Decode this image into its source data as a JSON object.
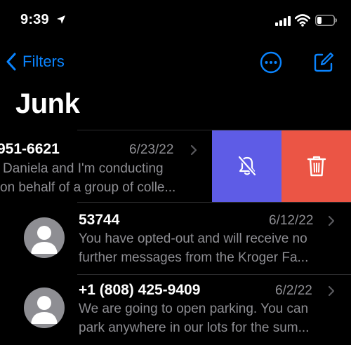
{
  "status_bar": {
    "time": "9:39"
  },
  "nav": {
    "back_label": "Filters"
  },
  "title": "Junk",
  "messages": [
    {
      "sender": "951-6621",
      "date": "6/23/22",
      "preview_line1": "Daniela and I'm conducting",
      "preview_line2": "on behalf of a group of colle..."
    },
    {
      "sender": "53744",
      "date": "6/12/22",
      "preview_line1": "You have opted-out and will receive no",
      "preview_line2": "further messages from the Kroger Fa..."
    },
    {
      "sender": "+1 (808) 425-9409",
      "date": "6/2/22",
      "preview_line1": "We are going to open parking. You can",
      "preview_line2": "park anywhere in our lots for the sum..."
    }
  ],
  "swipe_actions": [
    {
      "icon": "bell-slash-icon",
      "color": "#5e5ce6"
    },
    {
      "icon": "trash-icon",
      "color": "#eb5545"
    }
  ],
  "colors": {
    "accent": "#0a84ff",
    "secondary_text": "#8e8e93",
    "background": "#000000"
  }
}
